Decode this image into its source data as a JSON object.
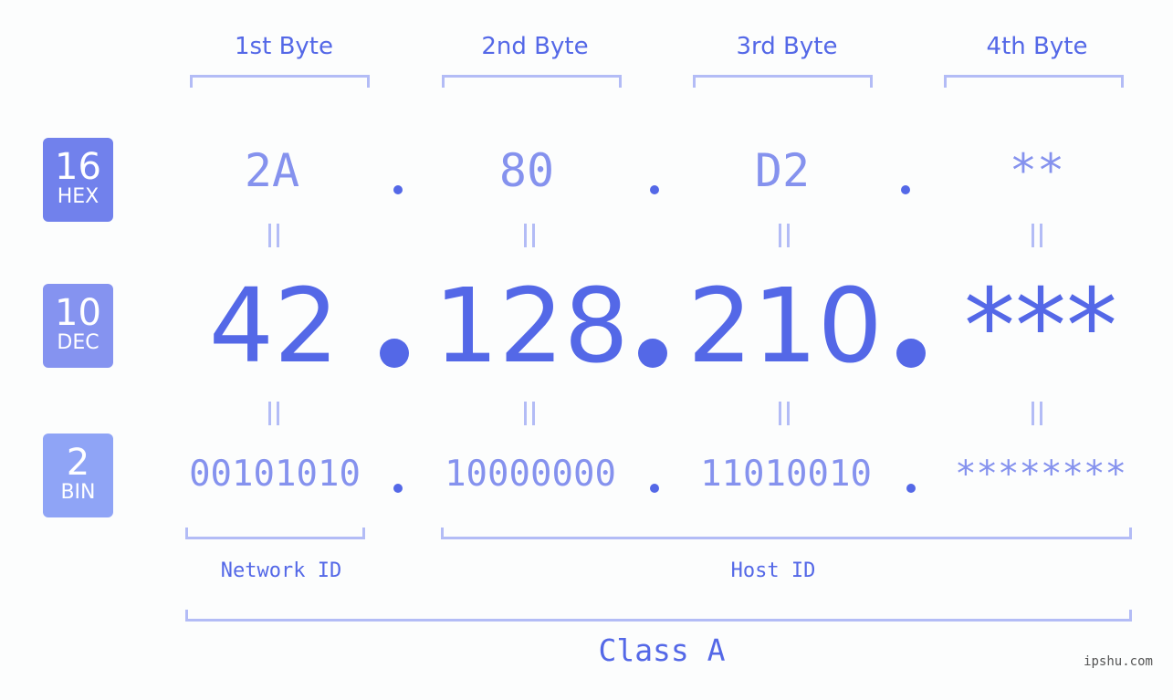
{
  "bytes": [
    {
      "header": "1st Byte",
      "hex": "2A",
      "dec": "42",
      "bin": "00101010"
    },
    {
      "header": "2nd Byte",
      "hex": "80",
      "dec": "128",
      "bin": "10000000"
    },
    {
      "header": "3rd Byte",
      "hex": "D2",
      "dec": "210",
      "bin": "11010010"
    },
    {
      "header": "4th Byte",
      "hex": "**",
      "dec": "***",
      "bin": "********"
    }
  ],
  "bases": [
    {
      "number": "16",
      "label": "HEX",
      "color": "#7181ec"
    },
    {
      "number": "10",
      "label": "DEC",
      "color": "#8593f0"
    },
    {
      "number": "2",
      "label": "BIN",
      "color": "#8fa4f6"
    }
  ],
  "segments": {
    "network": "Network ID",
    "host": "Host ID"
  },
  "ip_class": "Class A",
  "watermark": "ipshu.com",
  "colors": {
    "accent": "#5468e7",
    "muted": "#8592ee",
    "bracket": "#b3bcf6",
    "background": "#fcfdfd"
  }
}
